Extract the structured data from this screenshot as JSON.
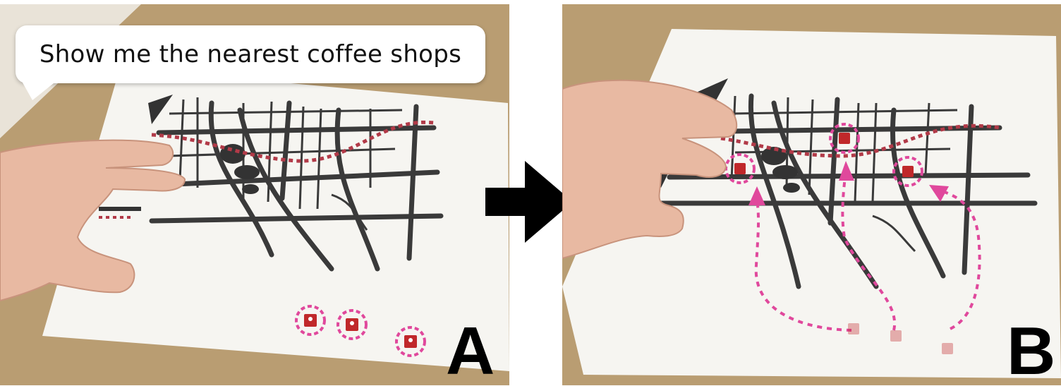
{
  "speech": {
    "text": "Show me the nearest coffee shops"
  },
  "panels": {
    "a": {
      "label": "A"
    },
    "b": {
      "label": "B"
    }
  },
  "icons": {
    "transition_arrow": "right-arrow-icon",
    "marker": "map-pin-icon"
  },
  "colors": {
    "marker_red": "#c0282a",
    "highlight_magenta": "#e0489c",
    "route_dotted": "#b23a48",
    "street_dark": "#3a3a3a",
    "table_brown": "#b99d72"
  }
}
